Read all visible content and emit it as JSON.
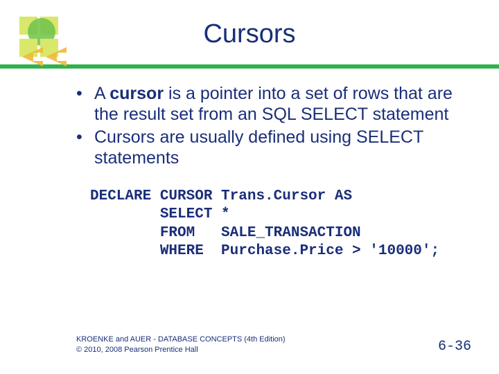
{
  "title": "Cursors",
  "bullets": [
    {
      "pre": "A ",
      "bold": "cursor",
      "post": " is a pointer into a set of rows that are the result set from an SQL SELECT statement"
    },
    {
      "pre": "Cursors are usually defined using SELECT statements",
      "bold": "",
      "post": ""
    }
  ],
  "code": {
    "l1": "DECLARE CURSOR Trans.Cursor AS",
    "l2": "        SELECT *",
    "l3": "        FROM   SALE_TRANSACTION",
    "l4": "        WHERE  Purchase.Price > '10000';"
  },
  "footer": {
    "line1": "KROENKE and AUER - DATABASE CONCEPTS (4th Edition)",
    "line2": "© 2010, 2008 Pearson Prentice Hall",
    "page": "6-36"
  }
}
